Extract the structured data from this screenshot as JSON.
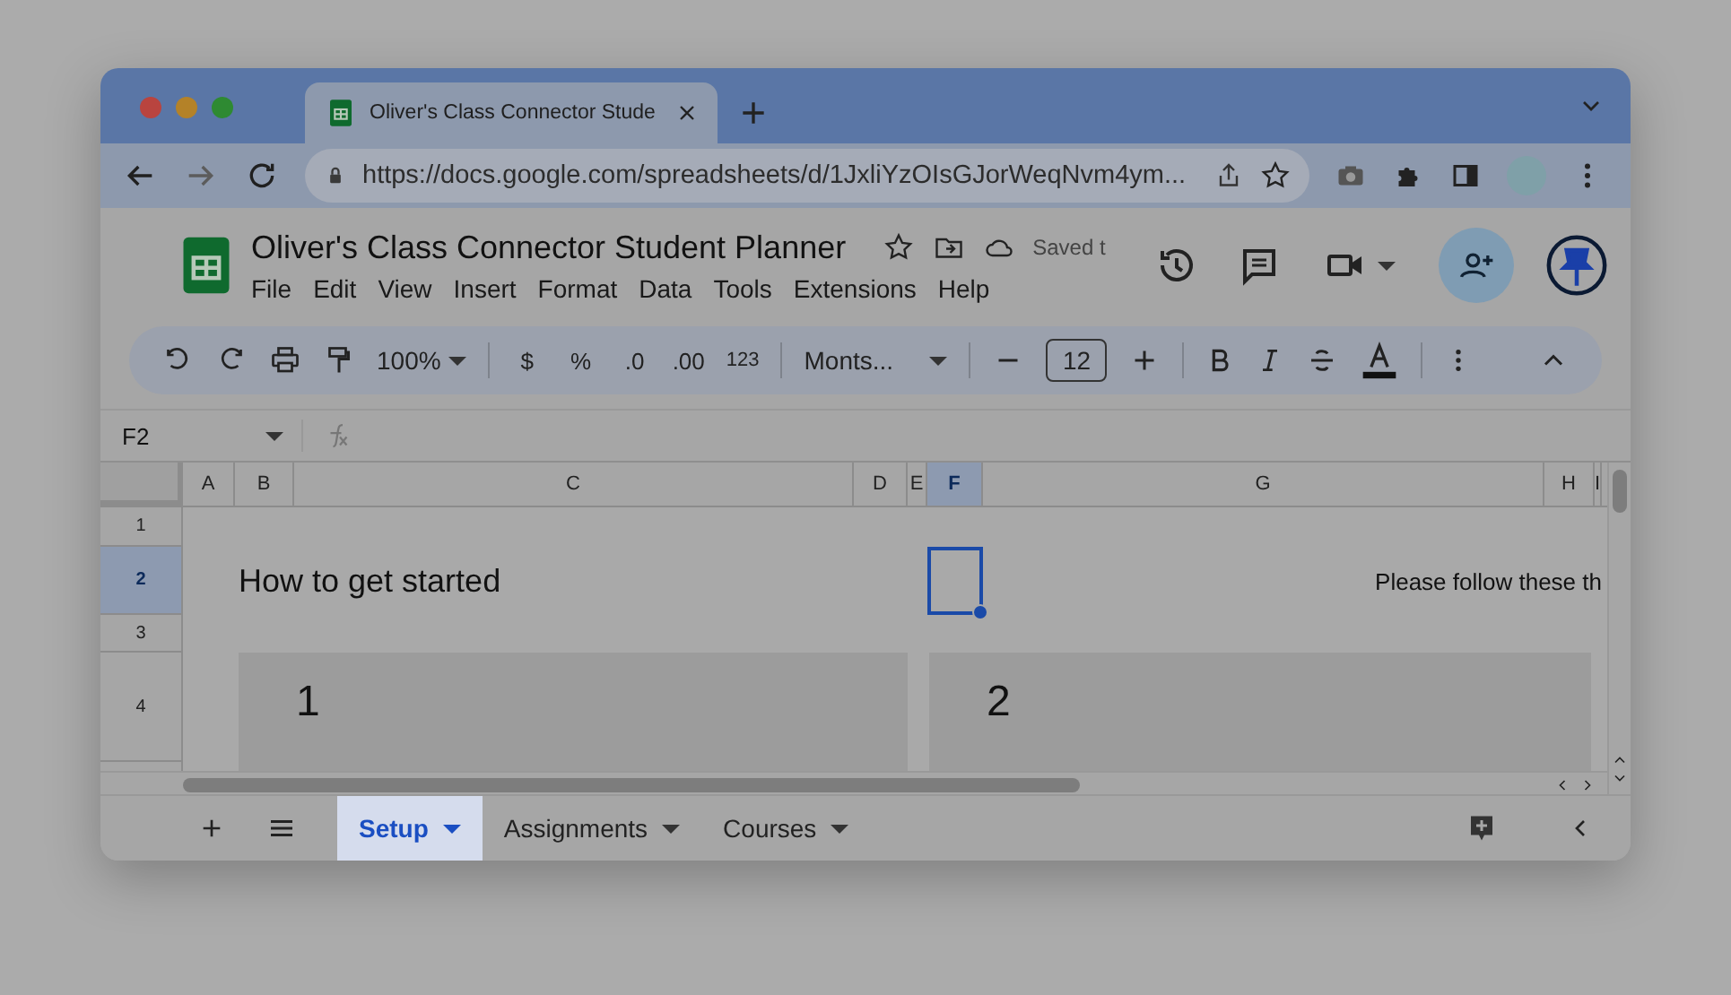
{
  "browser": {
    "tab_title": "Oliver's Class Connector Stude",
    "url": "https://docs.google.com/spreadsheets/d/1JxliYzOIsGJorWeqNvm4ym..."
  },
  "document": {
    "title": "Oliver's Class Connector Student Planner",
    "save_status": "Saved t",
    "menu": [
      "File",
      "Edit",
      "View",
      "Insert",
      "Format",
      "Data",
      "Tools",
      "Extensions",
      "Help"
    ]
  },
  "toolbar": {
    "zoom": "100%",
    "currency": "$",
    "percent": "%",
    "decrease_decimals": ".0",
    "increase_decimals": ".00",
    "number_format": "123",
    "font": "Monts...",
    "font_size": "12"
  },
  "formula_bar": {
    "cell_reference": "F2"
  },
  "columns": [
    {
      "label": "A",
      "selected": false
    },
    {
      "label": "B",
      "selected": false
    },
    {
      "label": "C",
      "selected": false
    },
    {
      "label": "D",
      "selected": false
    },
    {
      "label": "E",
      "selected": false
    },
    {
      "label": "F",
      "selected": true
    },
    {
      "label": "G",
      "selected": false
    },
    {
      "label": "H",
      "selected": false
    },
    {
      "label": "I",
      "selected": false
    }
  ],
  "rows": [
    {
      "label": "1",
      "selected": false
    },
    {
      "label": "2",
      "selected": true
    },
    {
      "label": "3",
      "selected": false
    },
    {
      "label": "4",
      "selected": false
    }
  ],
  "cells": {
    "heading": "How to get started",
    "instructions": "Please follow these th",
    "cards": [
      "1",
      "2"
    ]
  },
  "sheet_tabs": [
    {
      "label": "Setup",
      "selected": true
    },
    {
      "label": "Assignments",
      "selected": false
    },
    {
      "label": "Courses",
      "selected": false
    }
  ]
}
